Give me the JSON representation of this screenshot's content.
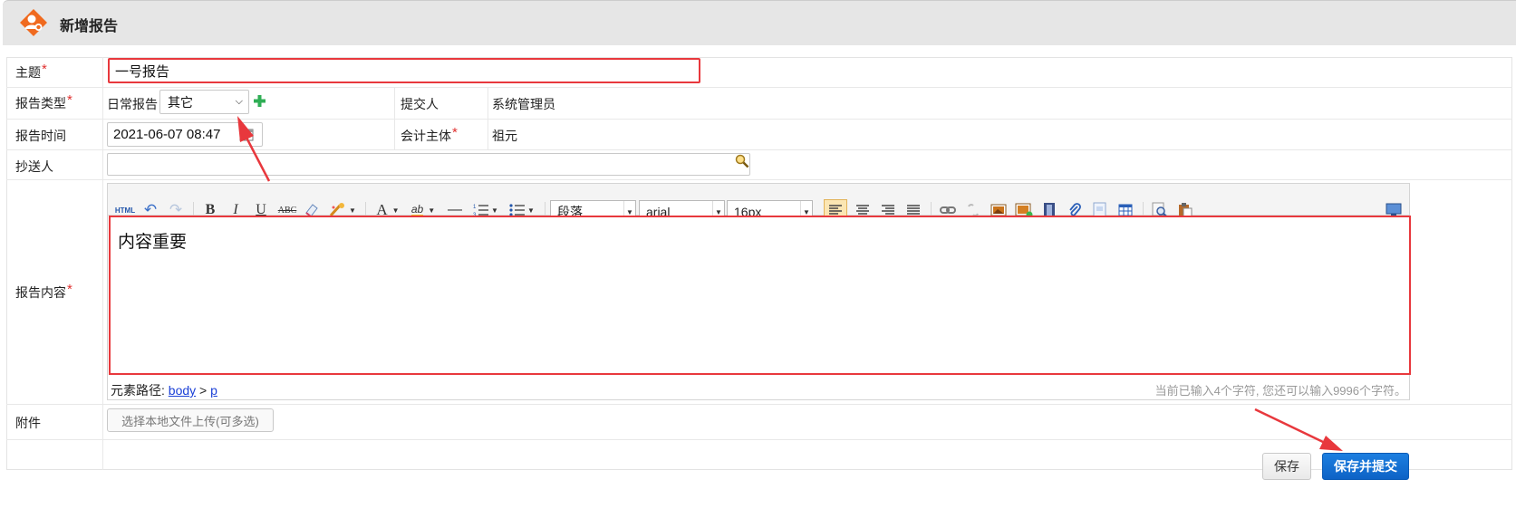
{
  "header": {
    "title": "新增报告",
    "icon": "user-report-icon",
    "accent": "#f06a1f"
  },
  "form": {
    "subject": {
      "label": "主题",
      "required_mark": "*",
      "value": "一号报告"
    },
    "report_type": {
      "label": "报告类型",
      "required_mark": "*",
      "category": "日常报告",
      "selected": "其它",
      "add_icon": "plus-icon"
    },
    "submitter": {
      "label": "提交人",
      "value": "系统管理员"
    },
    "report_time": {
      "label": "报告时间",
      "value": "2021-06-07 08:47"
    },
    "accounting_entity": {
      "label": "会计主体",
      "required_mark": "*",
      "value": "祖元"
    },
    "cc": {
      "label": "抄送人",
      "value": ""
    },
    "content": {
      "label": "报告内容",
      "required_mark": "*",
      "text": "内容重要",
      "paragraph_format": "段落",
      "font_family": "arial",
      "font_size": "16px",
      "path_label": "元素路径:",
      "path_body": "body",
      "path_sep": ">",
      "path_p": "p",
      "char_count": "当前已输入4个字符, 您还可以输入9996个字符。"
    },
    "attachment": {
      "label": "附件",
      "button": "选择本地文件上传(可多选)"
    }
  },
  "toolbar_icons": {
    "html": "HTML",
    "bold": "B",
    "italic": "I",
    "underline": "U",
    "strike": "ABC",
    "font_color": "A",
    "highlight": "ab"
  },
  "actions": {
    "save": "保存",
    "save_submit": "保存并提交"
  },
  "colors": {
    "annotation_red": "#e8383d",
    "primary_blue": "#0d63c6"
  }
}
